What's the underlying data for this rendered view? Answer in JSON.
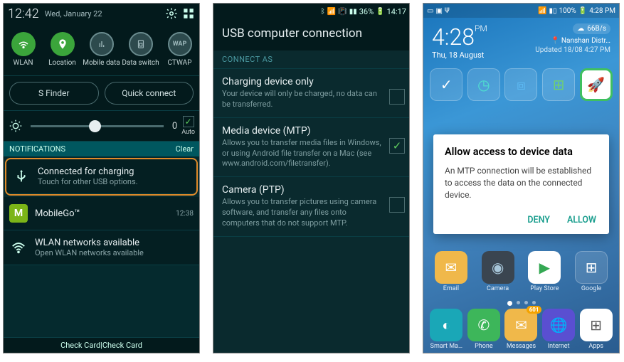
{
  "p1": {
    "clock": "12:42",
    "date": "Wed, January 22",
    "qtoggles": [
      {
        "label": "WLAN",
        "on": true,
        "glyph": "wifi"
      },
      {
        "label": "Location",
        "on": true,
        "glyph": "pin"
      },
      {
        "label": "Mobile data",
        "on": false,
        "glyph": "data"
      },
      {
        "label": "Data switch",
        "on": false,
        "glyph": "sim"
      },
      {
        "label": "CTWAP",
        "on": false,
        "glyph": "WAP"
      }
    ],
    "buttons": {
      "sfinder": "S Finder",
      "quickconnect": "Quick connect"
    },
    "brightness": {
      "value": "0",
      "auto_label": "Auto",
      "auto_checked": true
    },
    "notif_header": "NOTIFICATIONS",
    "clear": "Clear",
    "notifications": [
      {
        "title": "Connected for charging",
        "sub": "Touch for other USB options.",
        "time": "",
        "icon": "usb",
        "hl": true
      },
      {
        "title": "MobileGo™",
        "sub": "",
        "time": "12:38",
        "icon": "mgo"
      },
      {
        "title": "WLAN networks available",
        "sub": "Open WLAN networks available",
        "time": "",
        "icon": "wifi"
      }
    ],
    "footer": "Check Card|Check Card"
  },
  "p2": {
    "status": {
      "battery": "36%",
      "time": "14:17"
    },
    "title": "USB computer connection",
    "section": "CONNECT AS",
    "options": [
      {
        "title": "Charging device only",
        "desc": "Your device will only be charged, no data can be transferred.",
        "checked": false
      },
      {
        "title": "Media device (MTP)",
        "desc": "Allows you to transfer media files in Windows, or using Android file transfer on a Mac (see www.android.com/filetransfer).",
        "checked": true
      },
      {
        "title": "Camera (PTP)",
        "desc": "Allows you to transfer pictures using camera software, and transfer any files onto computers that do not support MTP.",
        "checked": false
      }
    ]
  },
  "p3": {
    "status": {
      "battery": "100%",
      "time": "4:28 PM"
    },
    "speed": "66B/s",
    "clock": "4:28",
    "ampm": "PM",
    "date": "Thu, 18 August",
    "location": "Nanshan Distr…",
    "updated": "Updated 18/08 4:27 PM",
    "dialog": {
      "title": "Allow access to device data",
      "body": "An MTP connection will be established to access the data on the connected device.",
      "deny": "DENY",
      "allow": "ALLOW"
    },
    "row_apps": [
      {
        "label": "Email",
        "glyph": "✉",
        "color": "#f0b84a"
      },
      {
        "label": "Camera",
        "glyph": "◉",
        "color": "#a7c6d9"
      },
      {
        "label": "Play Store",
        "glyph": "▶",
        "color": "#fff"
      },
      {
        "label": "Google",
        "glyph": "📁",
        "color": "#444"
      }
    ],
    "dock": [
      {
        "label": "Smart Ma…",
        "glyph": "◐",
        "color": "#1aa7b7"
      },
      {
        "label": "Phone",
        "glyph": "✆",
        "color": "#3db65a"
      },
      {
        "label": "Messages",
        "glyph": "✉",
        "color": "#f0b84a",
        "badge": "601"
      },
      {
        "label": "Internet",
        "glyph": "🌐",
        "color": "#5a4fd1"
      },
      {
        "label": "Apps",
        "glyph": "⊞",
        "color": "#fff"
      }
    ],
    "top_row_visible": true
  }
}
